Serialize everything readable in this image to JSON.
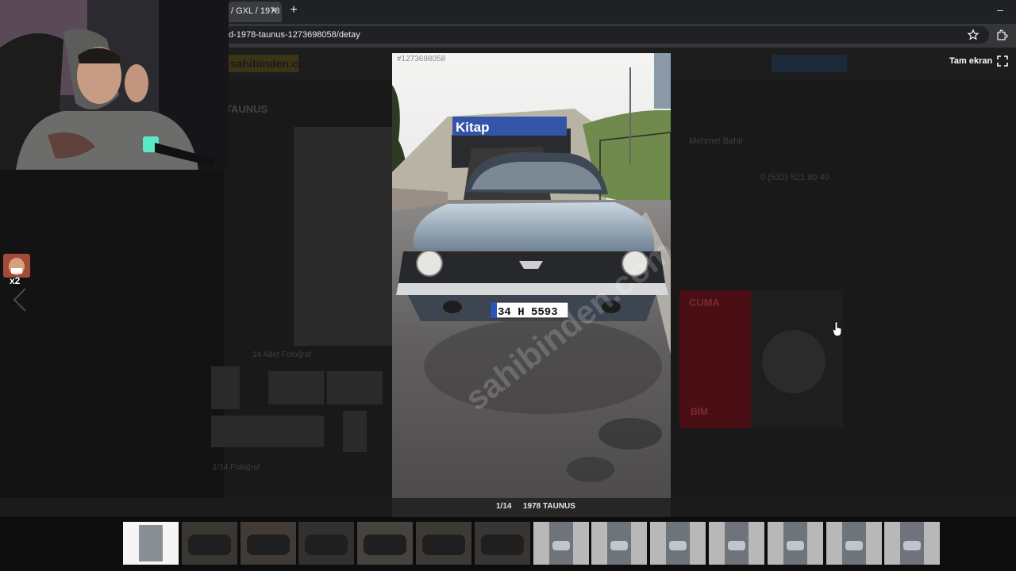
{
  "browser": {
    "tab_title": "/ GXL / 1978",
    "url": "d-1978-taunus-1273698058/detay",
    "tab_close_glyph": "×",
    "new_tab_glyph": "+",
    "minimize_glyph": "–"
  },
  "background_page": {
    "logo": "sahibinden.com",
    "listing_title": "TAUNUS",
    "seller_name": "Mehmet Bahir",
    "seller_phone": "0 (532) 521 80 40",
    "ad_headline": "CUMA",
    "ad_brand": "BİM",
    "thumbnails_label": "14 Adet Fotoğraf",
    "photo_count_label": "1/14 Fotoğraf"
  },
  "viewer": {
    "photo_number": "#1273698058",
    "fullscreen_label": "Tam ekran",
    "counter": "1/14",
    "title": "1978 TAUNUS",
    "photo_scene": {
      "banner": "Kitap",
      "plate": "34 H 5593",
      "watermark": "sahibinden.com"
    },
    "thumbnail_count": 14,
    "selected_index": 1
  },
  "overlay": {
    "emote_count": "x2"
  }
}
